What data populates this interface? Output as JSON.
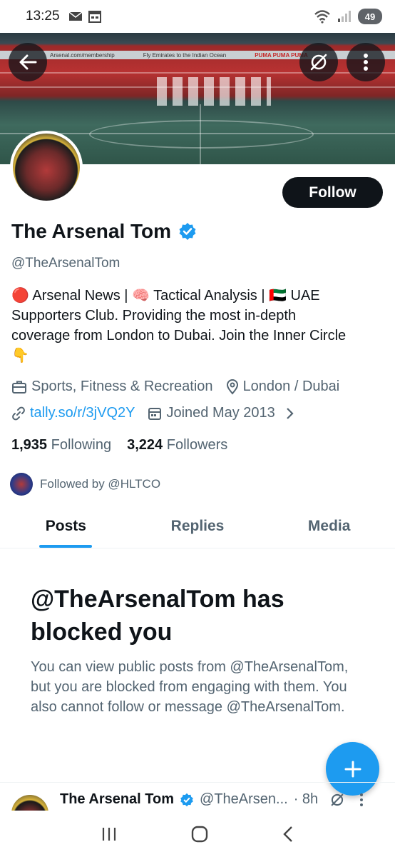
{
  "status": {
    "time": "13:25",
    "battery": "49"
  },
  "profile": {
    "name": "The Arsenal Tom",
    "handle": "@TheArsenalTom",
    "follow_label": "Follow",
    "bio_line1": "🔴 Arsenal News | 🧠 Tactical Analysis | 🇦🇪 UAE",
    "bio_line2": "Supporters Club. Providing the most in-depth",
    "bio_line3": "coverage from London to Dubai. Join the Inner Circle",
    "bio_line4": "👇",
    "category": "Sports, Fitness & Recreation",
    "location": "London / Dubai",
    "link": "tally.so/r/3jVQ2Y",
    "joined": "Joined May 2013",
    "following_count": "1,935",
    "following_label": "Following",
    "followers_count": "3,224",
    "followers_label": "Followers",
    "followed_by": "Followed by @HLTCO"
  },
  "tabs": [
    {
      "label": "Posts",
      "active": true
    },
    {
      "label": "Replies",
      "active": false
    },
    {
      "label": "Media",
      "active": false
    }
  ],
  "blocked": {
    "title": "@TheArsenalTom has blocked you",
    "text": "You can view public posts from @TheArsenalTom, but you are blocked from engaging with them. You also cannot follow or message @TheArsenalTom."
  },
  "post": {
    "name": "The Arsenal Tom",
    "handle": "@TheArsen...",
    "time": "· 8h"
  },
  "banner": {
    "stripe_text1": "Arsenal.com/membership",
    "stripe_text2": "Fly Emirates to the Indian Ocean",
    "stripe_text3": "PUMA PUMA PUMA"
  },
  "colors": {
    "accent": "#1d9bf0",
    "text": "#0f1419",
    "secondary": "#536471"
  }
}
